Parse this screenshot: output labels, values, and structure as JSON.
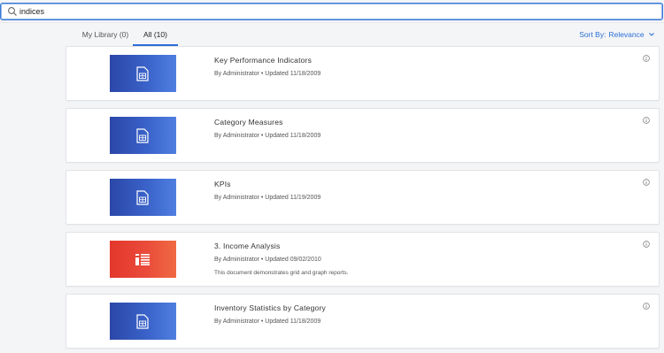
{
  "search": {
    "value": "indices",
    "placeholder": ""
  },
  "tabs": [
    {
      "label": "My Library (0)"
    },
    {
      "label": "All (10)"
    }
  ],
  "sort": {
    "label": "Sort By:",
    "value": "Relevance"
  },
  "results": [
    {
      "title": "Key Performance Indicators",
      "meta": "By Administrator • Updated 11/18/2009",
      "description": "",
      "thumb_color": "#2f53b6",
      "icon": "document-icon"
    },
    {
      "title": "Category Measures",
      "meta": "By Administrator • Updated 11/18/2009",
      "description": "",
      "thumb_color": "#2f53b6",
      "icon": "document-icon"
    },
    {
      "title": "KPIs",
      "meta": "By Administrator • Updated 11/19/2009",
      "description": "",
      "thumb_color": "#2f53b6",
      "icon": "document-icon"
    },
    {
      "title": "3. Income Analysis",
      "meta": "By Administrator • Updated 09/02/2010",
      "description": "This document demonstrates grid and graph reports.",
      "thumb_color": "#e8412f",
      "icon": "report-icon"
    },
    {
      "title": "Inventory Statistics by Category",
      "meta": "By Administrator • Updated 11/18/2009",
      "description": "",
      "thumb_color": "#2f53b6",
      "icon": "document-icon"
    }
  ]
}
